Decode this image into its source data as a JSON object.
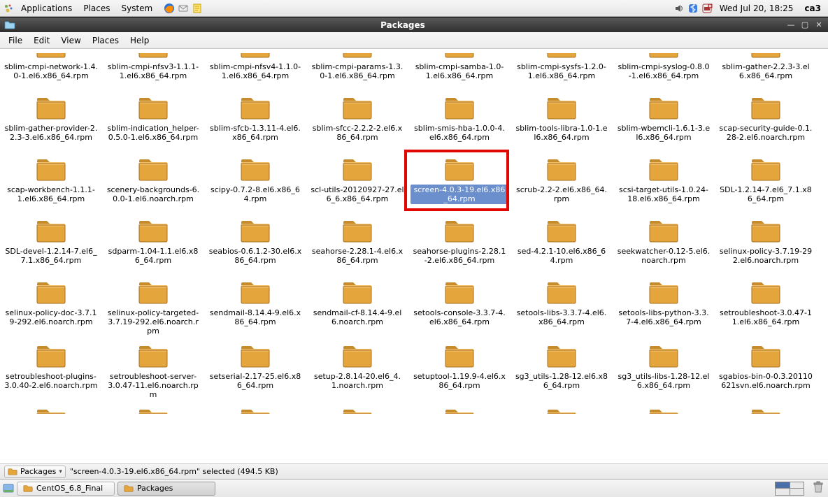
{
  "panel": {
    "applications": "Applications",
    "places": "Places",
    "system": "System",
    "clock": "Wed Jul 20, 18:25",
    "user": "ca3"
  },
  "window": {
    "title": "Packages"
  },
  "menubar": [
    "File",
    "Edit",
    "View",
    "Places",
    "Help"
  ],
  "files": [
    {
      "name": "sblim-cmpi-network-1.4.0-1.el6.x86_64.rpm",
      "first_row": true
    },
    {
      "name": "sblim-cmpi-nfsv3-1.1.1-1.el6.x86_64.rpm",
      "first_row": true
    },
    {
      "name": "sblim-cmpi-nfsv4-1.1.0-1.el6.x86_64.rpm",
      "first_row": true
    },
    {
      "name": "sblim-cmpi-params-1.3.0-1.el6.x86_64.rpm",
      "first_row": true
    },
    {
      "name": "sblim-cmpi-samba-1.0-1.el6.x86_64.rpm",
      "first_row": true
    },
    {
      "name": "sblim-cmpi-sysfs-1.2.0-1.el6.x86_64.rpm",
      "first_row": true
    },
    {
      "name": "sblim-cmpi-syslog-0.8.0-1.el6.x86_64.rpm",
      "first_row": true
    },
    {
      "name": "sblim-gather-2.2.3-3.el6.x86_64.rpm",
      "first_row": true
    },
    {
      "name": "sblim-gather-provider-2.2.3-3.el6.x86_64.rpm"
    },
    {
      "name": "sblim-indication_helper-0.5.0-1.el6.x86_64.rpm"
    },
    {
      "name": "sblim-sfcb-1.3.11-4.el6.x86_64.rpm"
    },
    {
      "name": "sblim-sfcc-2.2.2-2.el6.x86_64.rpm"
    },
    {
      "name": "sblim-smis-hba-1.0.0-4.el6.x86_64.rpm"
    },
    {
      "name": "sblim-tools-libra-1.0-1.el6.x86_64.rpm"
    },
    {
      "name": "sblim-wbemcli-1.6.1-3.el6.x86_64.rpm"
    },
    {
      "name": "scap-security-guide-0.1.28-2.el6.noarch.rpm"
    },
    {
      "name": "scap-workbench-1.1.1-1.el6.x86_64.rpm"
    },
    {
      "name": "scenery-backgrounds-6.0.0-1.el6.noarch.rpm"
    },
    {
      "name": "scipy-0.7.2-8.el6.x86_64.rpm"
    },
    {
      "name": "scl-utils-20120927-27.el6_6.x86_64.rpm"
    },
    {
      "name": "screen-4.0.3-19.el6.x86_64.rpm",
      "selected": true
    },
    {
      "name": "scrub-2.2-2.el6.x86_64.rpm"
    },
    {
      "name": "scsi-target-utils-1.0.24-18.el6.x86_64.rpm"
    },
    {
      "name": "SDL-1.2.14-7.el6_7.1.x86_64.rpm"
    },
    {
      "name": "SDL-devel-1.2.14-7.el6_7.1.x86_64.rpm"
    },
    {
      "name": "sdparm-1.04-1.1.el6.x86_64.rpm"
    },
    {
      "name": "seabios-0.6.1.2-30.el6.x86_64.rpm"
    },
    {
      "name": "seahorse-2.28.1-4.el6.x86_64.rpm"
    },
    {
      "name": "seahorse-plugins-2.28.1-2.el6.x86_64.rpm"
    },
    {
      "name": "sed-4.2.1-10.el6.x86_64.rpm"
    },
    {
      "name": "seekwatcher-0.12-5.el6.noarch.rpm"
    },
    {
      "name": "selinux-policy-3.7.19-292.el6.noarch.rpm"
    },
    {
      "name": "selinux-policy-doc-3.7.19-292.el6.noarch.rpm"
    },
    {
      "name": "selinux-policy-targeted-3.7.19-292.el6.noarch.rpm"
    },
    {
      "name": "sendmail-8.14.4-9.el6.x86_64.rpm"
    },
    {
      "name": "sendmail-cf-8.14.4-9.el6.noarch.rpm"
    },
    {
      "name": "setools-console-3.3.7-4.el6.x86_64.rpm"
    },
    {
      "name": "setools-libs-3.3.7-4.el6.x86_64.rpm"
    },
    {
      "name": "setools-libs-python-3.3.7-4.el6.x86_64.rpm"
    },
    {
      "name": "setroubleshoot-3.0.47-11.el6.x86_64.rpm"
    },
    {
      "name": "setroubleshoot-plugins-3.0.40-2.el6.noarch.rpm"
    },
    {
      "name": "setroubleshoot-server-3.0.47-11.el6.noarch.rpm"
    },
    {
      "name": "setserial-2.17-25.el6.x86_64.rpm"
    },
    {
      "name": "setup-2.8.14-20.el6_4.1.noarch.rpm"
    },
    {
      "name": "setuptool-1.19.9-4.el6.x86_64.rpm"
    },
    {
      "name": "sg3_utils-1.28-12.el6.x86_64.rpm"
    },
    {
      "name": "sg3_utils-libs-1.28-12.el6.x86_64.rpm"
    },
    {
      "name": "sgabios-bin-0-0.3.20110621svn.el6.noarch.rpm"
    }
  ],
  "statusbar": {
    "location_label": "Packages",
    "selection_status": "\"screen-4.0.3-19.el6.x86_64.rpm\" selected (494.5 KB)"
  },
  "taskbar": {
    "task1": "CentOS_6.8_Final",
    "task2": "Packages"
  }
}
